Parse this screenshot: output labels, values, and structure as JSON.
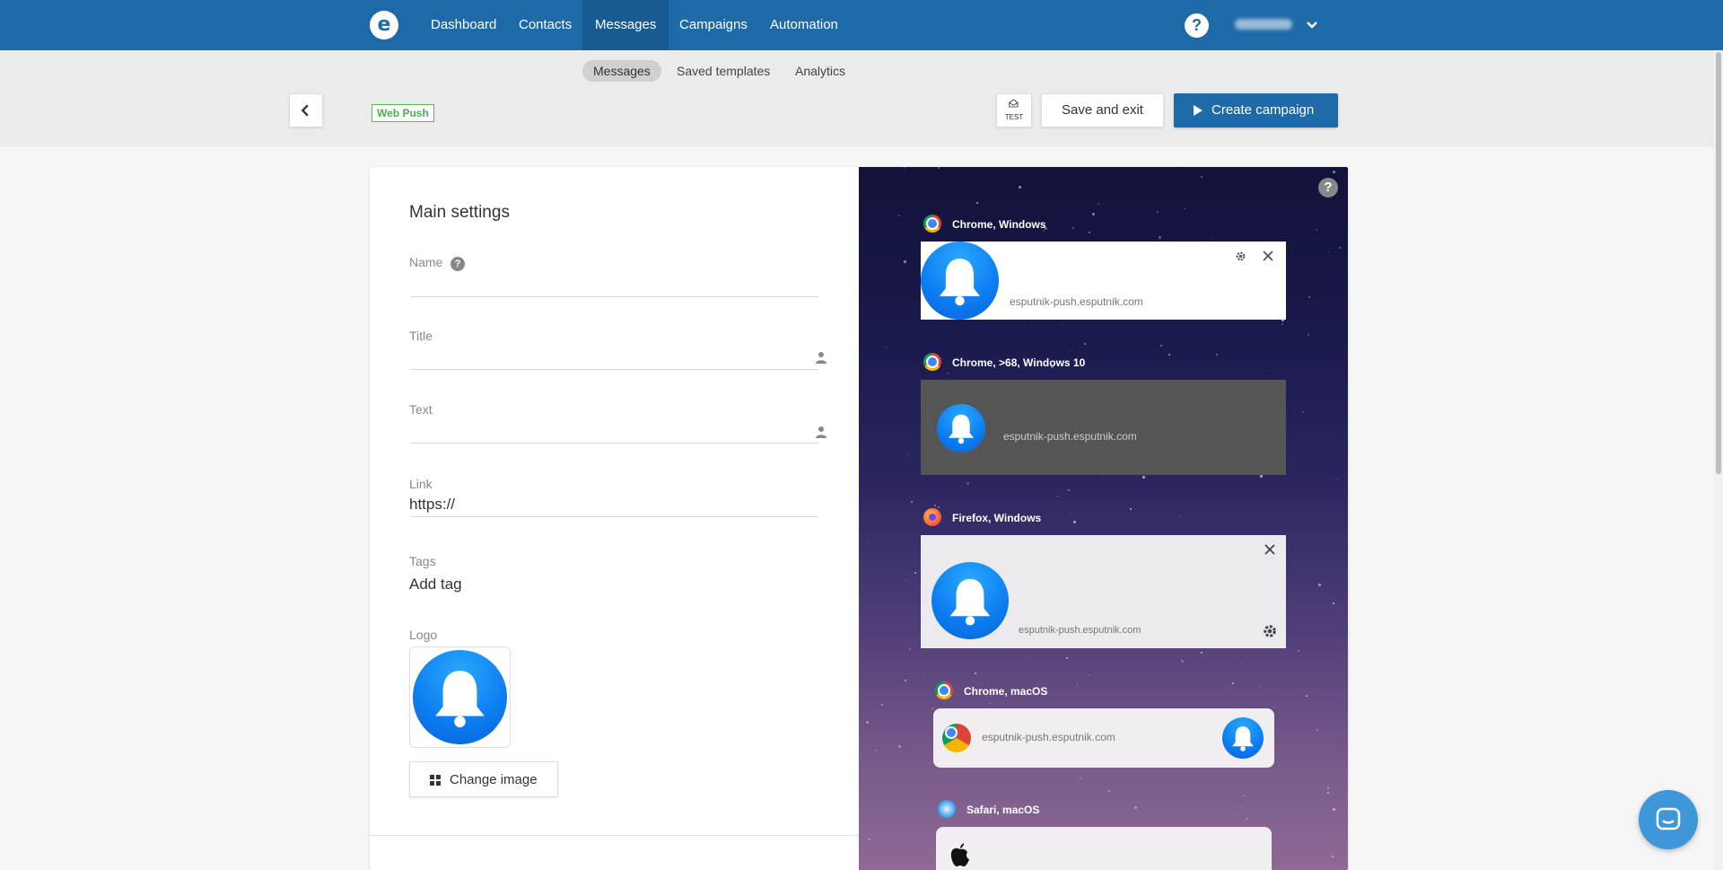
{
  "nav": {
    "items": [
      {
        "label": "Dashboard",
        "active": false
      },
      {
        "label": "Contacts",
        "active": false
      },
      {
        "label": "Messages",
        "active": true
      },
      {
        "label": "Campaigns",
        "active": false
      },
      {
        "label": "Automation",
        "active": false
      }
    ],
    "help_label": "?"
  },
  "subnav": {
    "tabs": [
      {
        "label": "Messages",
        "active": true
      },
      {
        "label": "Saved templates",
        "active": false
      },
      {
        "label": "Analytics",
        "active": false
      }
    ]
  },
  "toolbar": {
    "badge": "Web Push",
    "test_label": "TEST",
    "save_label": "Save and exit",
    "create_label": "Create campaign"
  },
  "settings": {
    "heading": "Main settings",
    "name_label": "Name",
    "name_help": "?",
    "title_label": "Title",
    "text_label": "Text",
    "link_label": "Link",
    "link_value": "https://",
    "tags_label": "Tags",
    "tags_value": "Add tag",
    "logo_label": "Logo",
    "change_image_label": "Change image"
  },
  "preview": {
    "help": "?",
    "items": [
      {
        "browser": "Chrome, Windows",
        "url": "esputnik-push.esputnik.com"
      },
      {
        "browser": "Chrome, >68, Windows 10",
        "url": "esputnik-push.esputnik.com"
      },
      {
        "browser": "Firefox, Windows",
        "url": "esputnik-push.esputnik.com"
      },
      {
        "browser": "Chrome, macOS",
        "url": "esputnik-push.esputnik.com"
      },
      {
        "browser": "Safari, macOS",
        "url": ""
      }
    ]
  },
  "colors": {
    "brand": "#1e6aa8",
    "badge_green": "#4cae4c",
    "bell_blue": "#0b7cf0"
  }
}
